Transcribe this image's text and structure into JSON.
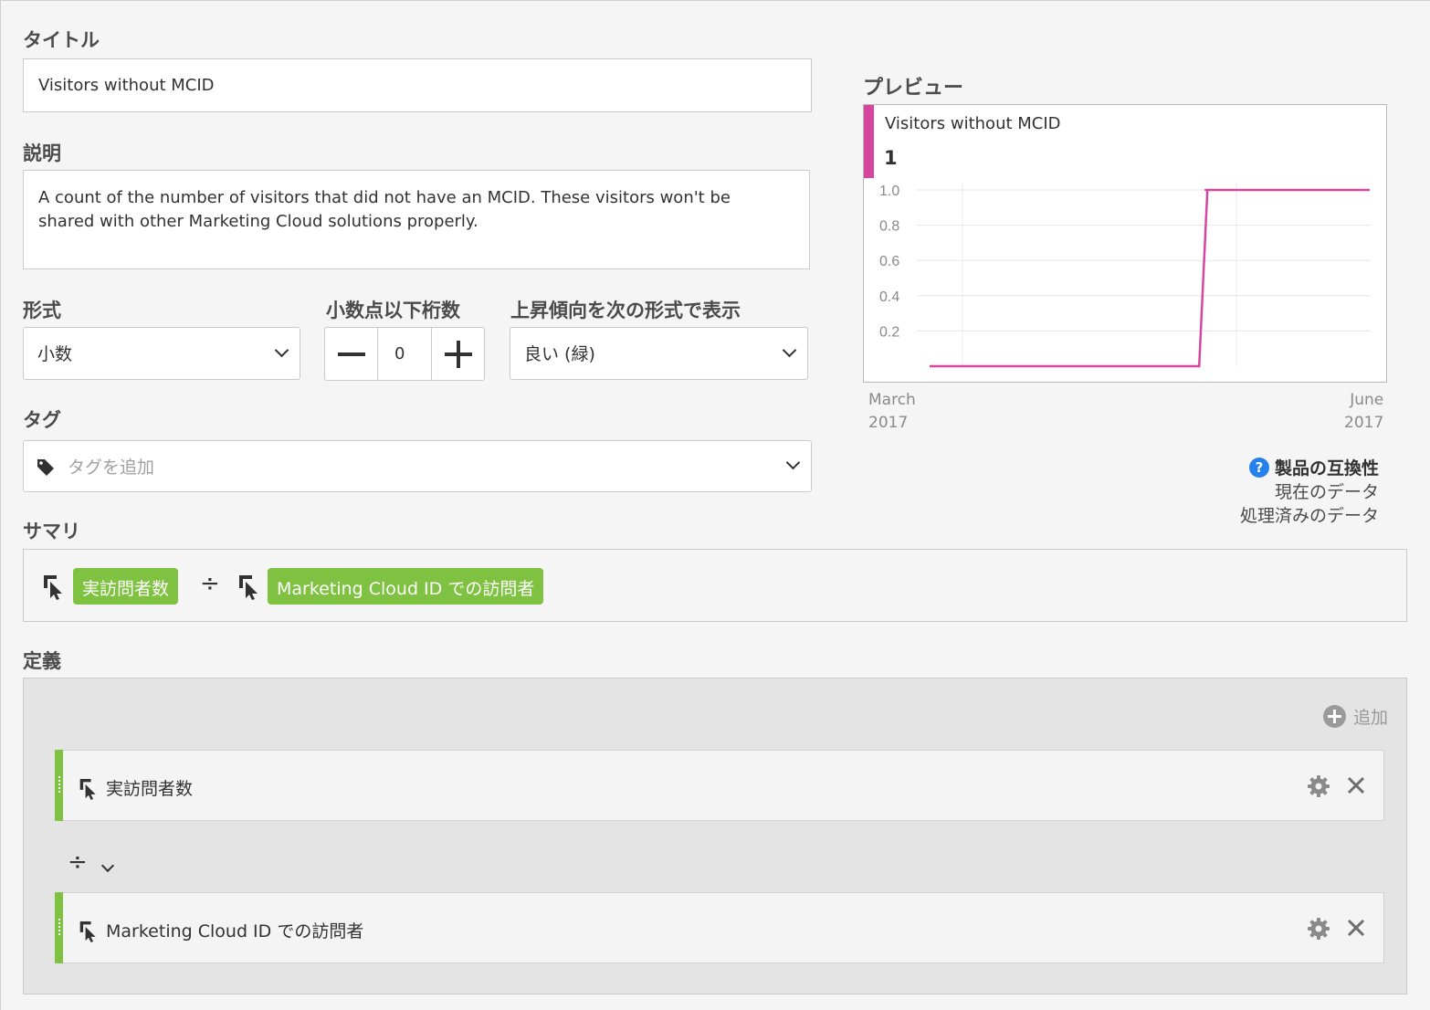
{
  "fields": {
    "title_label": "タイトル",
    "title_value": "Visitors without MCID",
    "description_label": "説明",
    "description_value": "A count of the number of visitors that did not have an MCID. These visitors won't be shared with other Marketing Cloud solutions properly.",
    "format_label": "形式",
    "format_value": "小数",
    "decimals_label": "小数点以下桁数",
    "decimals_value": "0",
    "trend_label": "上昇傾向を次の形式で表示",
    "trend_value": "良い (緑)",
    "tags_label": "タグ",
    "tags_placeholder": "タグを追加"
  },
  "preview": {
    "label": "プレビュー",
    "metric_name": "Visitors without MCID",
    "metric_value": "1",
    "accent_color": "#d6469f",
    "x_start_month": "March",
    "x_start_year": "2017",
    "x_end_month": "June",
    "x_end_year": "2017"
  },
  "chart_data": {
    "type": "line",
    "y_ticks": [
      "1.0",
      "0.8",
      "0.6",
      "0.4",
      "0.2"
    ],
    "ylim": [
      0,
      1.0
    ],
    "grid": true,
    "x": [
      "March 2017",
      "",
      "",
      "",
      "",
      "",
      "",
      "",
      "June 2017"
    ],
    "series": [
      {
        "values": [
          0,
          0,
          0,
          0,
          0,
          1,
          1,
          1,
          1
        ],
        "color": "#d6469f"
      }
    ]
  },
  "compatibility": {
    "heading": "製品の互換性",
    "line1": "現在のデータ",
    "line2": "処理済みのデータ",
    "icon": "help-icon"
  },
  "summary": {
    "label": "サマリ",
    "operand1": "実訪問者数",
    "operator": "÷",
    "operand2": "Marketing Cloud ID での訪問者",
    "pill_color": "#7fc241"
  },
  "definition": {
    "label": "定義",
    "add_label": "追加",
    "row1_name": "実訪問者数",
    "operator": "÷",
    "row2_name": "Marketing Cloud ID での訪問者"
  }
}
